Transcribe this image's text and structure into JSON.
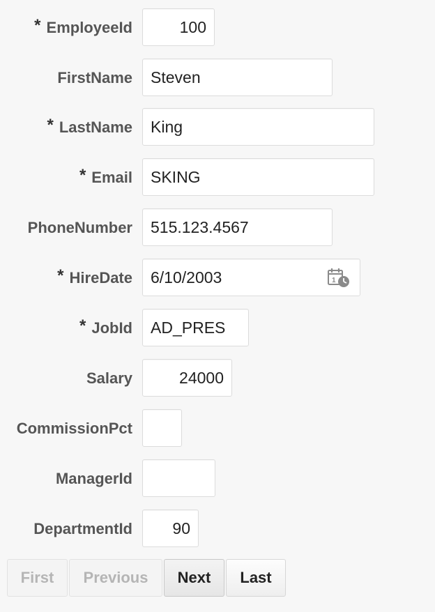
{
  "form": {
    "fields": {
      "employee_id": {
        "label": "EmployeeId",
        "required": "*",
        "value": "100"
      },
      "first_name": {
        "label": "FirstName",
        "value": "Steven"
      },
      "last_name": {
        "label": "LastName",
        "required": "*",
        "value": "King"
      },
      "email": {
        "label": "Email",
        "required": "*",
        "value": "SKING"
      },
      "phone_number": {
        "label": "PhoneNumber",
        "value": "515.123.4567"
      },
      "hire_date": {
        "label": "HireDate",
        "required": "*",
        "value": "6/10/2003",
        "icon": "calendar-icon"
      },
      "job_id": {
        "label": "JobId",
        "required": "*",
        "value": "AD_PRES"
      },
      "salary": {
        "label": "Salary",
        "value": "24000"
      },
      "commission_pct": {
        "label": "CommissionPct",
        "value": ""
      },
      "manager_id": {
        "label": "ManagerId",
        "value": ""
      },
      "department_id": {
        "label": "DepartmentId",
        "value": "90"
      }
    }
  },
  "pager": {
    "first_label": "First",
    "previous_label": "Previous",
    "next_label": "Next",
    "last_label": "Last",
    "first_enabled": false,
    "previous_enabled": false
  },
  "colors": {
    "background": "#f7f7f7",
    "label": "#555555",
    "field_border": "#dcdcdc",
    "disabled_text": "#b5b5b5"
  }
}
